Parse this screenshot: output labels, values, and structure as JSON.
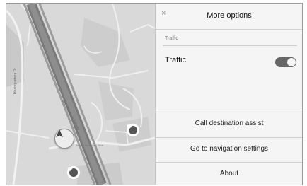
{
  "panel": {
    "title": "More options",
    "close_icon": "close-icon",
    "section_label": "Traffic",
    "traffic_toggle": {
      "label": "Traffic",
      "state": "on"
    },
    "menu_items": [
      {
        "label": "Call destination assist"
      },
      {
        "label": "Go to navigation settings"
      },
      {
        "label": "About"
      }
    ]
  },
  "map": {
    "street_labels": [
      "Headquarters Dr",
      "Sam Rayburn Tollway",
      "Toyota Motorway Blvd"
    ],
    "buttons": {
      "compass_icon": "navigation-arrow-icon",
      "poi_icon": "heart-icon"
    }
  },
  "colors": {
    "panel_bg": "#f5f5f5",
    "map_bg": "#d9d9d9",
    "toggle_on": "#666666"
  }
}
